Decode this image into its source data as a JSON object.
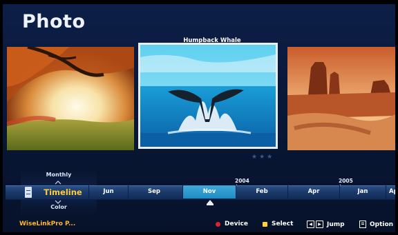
{
  "page_title": "Photo",
  "current_photo": {
    "caption": "Humpback Whale",
    "rating_stars": "★★★"
  },
  "photos": [
    {
      "id": "left",
      "icon": "autumn-tree-photo"
    },
    {
      "id": "center",
      "icon": "whale-tail-photo"
    },
    {
      "id": "right",
      "icon": "desert-mesa-photo"
    }
  ],
  "view_mode": {
    "above": "Monthly",
    "selected": "Timeline",
    "below": "Color"
  },
  "timeline": {
    "years": [
      {
        "label": "2004"
      },
      {
        "label": "2005"
      }
    ],
    "months": [
      "Jun",
      "Sep",
      "Nov",
      "Feb",
      "Apr",
      "Jan",
      "Ap"
    ],
    "active_month": "Nov"
  },
  "footer": {
    "source_label": "WiseLinkPro P...",
    "device_label": "Device",
    "select_label": "Select",
    "jump_label": "Jump",
    "option_label": "Option",
    "device_color": "#e0232b",
    "select_color": "#ffd23a"
  }
}
